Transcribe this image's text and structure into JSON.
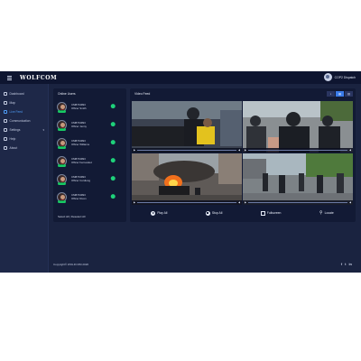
{
  "app": {
    "logo": "WOLFCOM",
    "user_name": "COP2 Dispatch"
  },
  "sidebar": {
    "items": [
      {
        "label": "Dashboard",
        "icon": "dashboard-icon"
      },
      {
        "label": "Map",
        "icon": "map-icon"
      },
      {
        "label": "Live Feed",
        "icon": "video-icon",
        "active": true
      },
      {
        "label": "Communication",
        "icon": "chat-icon"
      },
      {
        "label": "Settings",
        "icon": "gear-icon",
        "chevron": "▾"
      },
      {
        "label": "Help",
        "icon": "help-icon"
      },
      {
        "label": "About",
        "icon": "info-icon"
      }
    ]
  },
  "online_users": {
    "title": "Online Users",
    "status_label": "online",
    "officers": [
      {
        "id": "CM8743993",
        "name": "Officer Smith"
      },
      {
        "id": "CM8743993",
        "name": "Officer Jenny"
      },
      {
        "id": "CM8743993",
        "name": "Officer Williams"
      },
      {
        "id": "CM8743993",
        "name": "Officer Fernandez"
      },
      {
        "id": "CM8743993",
        "name": "Officer Cordiung"
      },
      {
        "id": "CM8743993",
        "name": "Officer Dixon"
      }
    ],
    "footer": "Select All | Deselect All"
  },
  "video_feed": {
    "title": "Video Feed",
    "layouts": [
      "▪",
      "▦",
      "▥"
    ],
    "tiles": [
      {
        "scene": "officer-and-protester"
      },
      {
        "scene": "riot-police-line"
      },
      {
        "scene": "burning-car"
      },
      {
        "scene": "street-crowd"
      }
    ],
    "controls": [
      {
        "label": "Play All",
        "icon": "play-icon"
      },
      {
        "label": "Stop All",
        "icon": "stop-icon"
      },
      {
        "label": "Fullscreen",
        "icon": "fullscreen-icon"
      },
      {
        "label": "Locate",
        "icon": "location-pin-icon"
      }
    ]
  },
  "footer": {
    "copyright": "Copyright© WOLFCOM 2020",
    "social": [
      "f",
      "t",
      "in"
    ]
  }
}
